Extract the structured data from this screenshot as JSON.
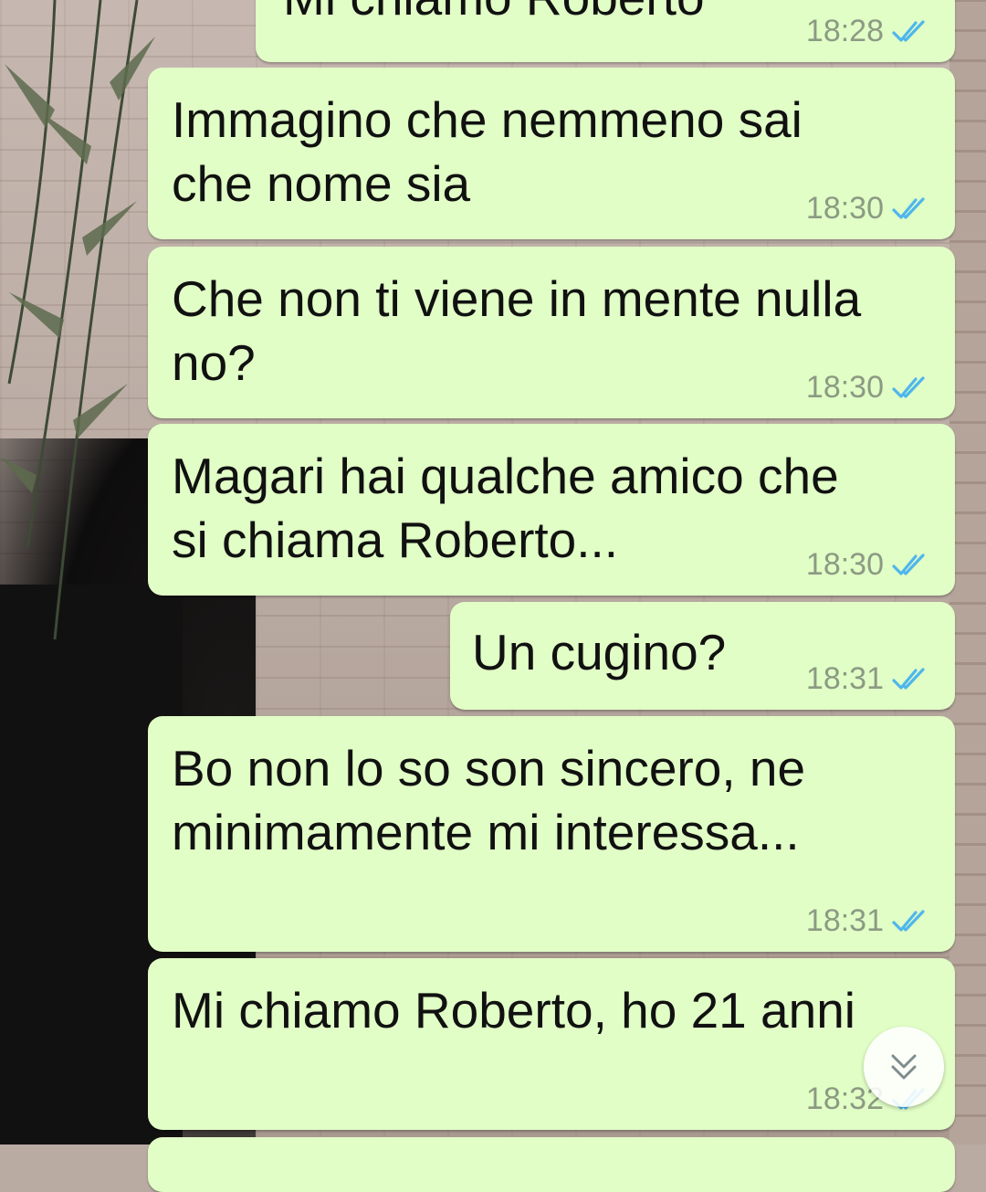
{
  "messages": [
    {
      "text": "Mi chiamo Roberto",
      "time": "18:28",
      "status": "read"
    },
    {
      "text": "Immagino che nemmeno sai\nche nome sia",
      "time": "18:30",
      "status": "read"
    },
    {
      "text": "Che non ti viene in mente nulla\nno?",
      "time": "18:30",
      "status": "read"
    },
    {
      "text": "Magari hai qualche amico che\nsi chiama Roberto...",
      "time": "18:30",
      "status": "read"
    },
    {
      "text": "Un cugino?",
      "time": "18:31",
      "status": "read"
    },
    {
      "text": "Bo non lo so son sincero, ne\nminimamente mi interessa...",
      "time": "18:31",
      "status": "read"
    },
    {
      "text": "Mi chiamo Roberto, ho 21 anni",
      "time": "18:32",
      "status": "read"
    }
  ],
  "scroll_button": {
    "icon": "double-chevron-down-icon"
  },
  "colors": {
    "bubble_out": "#e1fec6",
    "tick_read": "#4fb6ec",
    "time_text": "#8c9a83"
  }
}
